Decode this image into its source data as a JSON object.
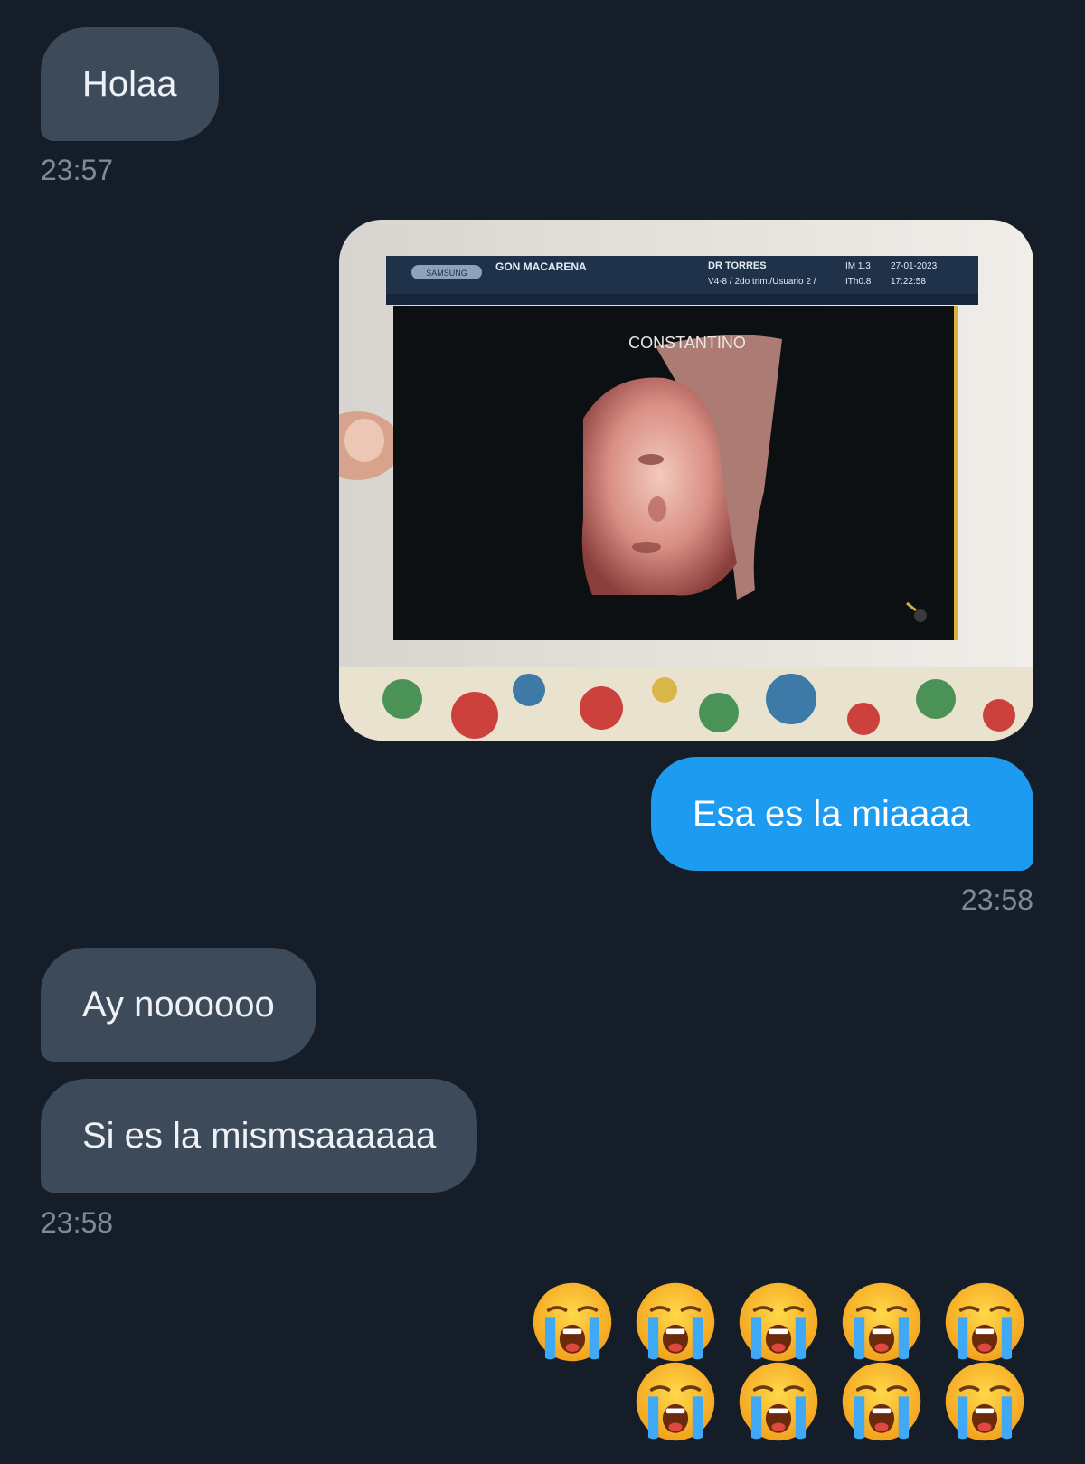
{
  "messages": [
    {
      "text": "Holaa",
      "time": "23:57"
    },
    {
      "image": {
        "header_name": "GON MACARENA",
        "header_doctor": "DR TORRES",
        "header_probe": "V4-8 / 2do trim./Usuario 2 /",
        "header_mi": "IM 1.3",
        "header_tib": "ITh0.8",
        "header_date": "27-01-2023",
        "header_clock": "17:22:58",
        "brand": "SAMSUNG",
        "caption": "CONSTANTINO"
      }
    },
    {
      "text": "Esa es la miaaaa",
      "time": "23:58"
    },
    {
      "text": "Ay noooooo"
    },
    {
      "text": "Si es la mismsaaaaaa",
      "time": "23:58"
    }
  ],
  "reaction": {
    "emoji": "😭",
    "count": 9
  },
  "colors": {
    "background": "#151d28",
    "incoming": "#3d4a59",
    "outgoing": "#1d9bf0"
  }
}
